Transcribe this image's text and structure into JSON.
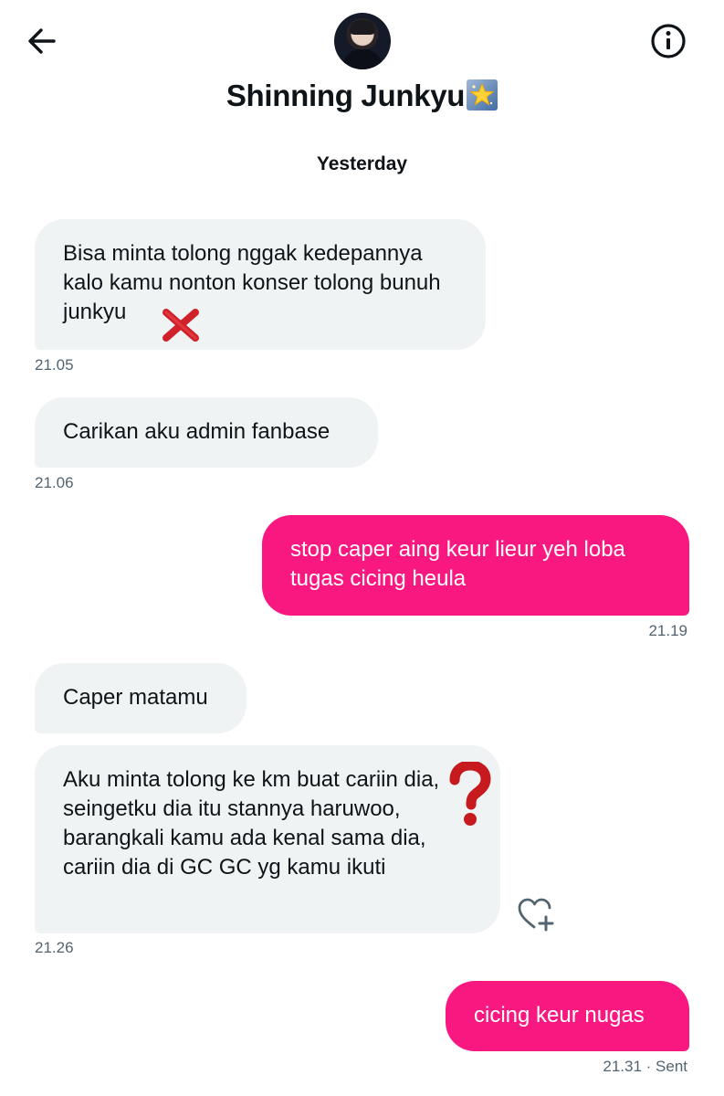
{
  "header": {
    "contact_name": "Shinning Junkyu",
    "icons": {
      "back": "arrow-left-icon",
      "info": "info-circle-icon",
      "title_emoji": "glowing-star-emoji"
    }
  },
  "date_separator": "Yesterday",
  "messages": [
    {
      "direction": "incoming",
      "text": "Bisa minta tolong nggak kedepannya kalo kamu nonton konser tolong bunuh junkyu",
      "time": "21.05"
    },
    {
      "direction": "incoming",
      "text": "Carikan aku admin fanbase",
      "time": "21.06"
    },
    {
      "direction": "outgoing",
      "text": "stop caper aing keur lieur yeh loba tugas cicing heula",
      "time": "21.19"
    },
    {
      "direction": "incoming",
      "text": "Caper matamu",
      "time": ""
    },
    {
      "direction": "incoming",
      "text": "Aku minta tolong ke km buat cariin dia, seingetku dia itu stannya haruwoo, barangkali kamu ada kenal sama dia, cariin dia di GC GC yg kamu ikuti",
      "time": "21.26"
    },
    {
      "direction": "outgoing",
      "text": "cicing keur nugas",
      "time": "21.31",
      "status": "· Sent"
    }
  ],
  "overlays": {
    "cross": "red-cross-mark-emoji",
    "question": "red-question-mark-emoji",
    "reaction": "heart-plus-icon"
  },
  "colors": {
    "outgoing_bubble": "#f91880",
    "incoming_bubble": "#eff3f4",
    "timestamp": "#536471"
  }
}
